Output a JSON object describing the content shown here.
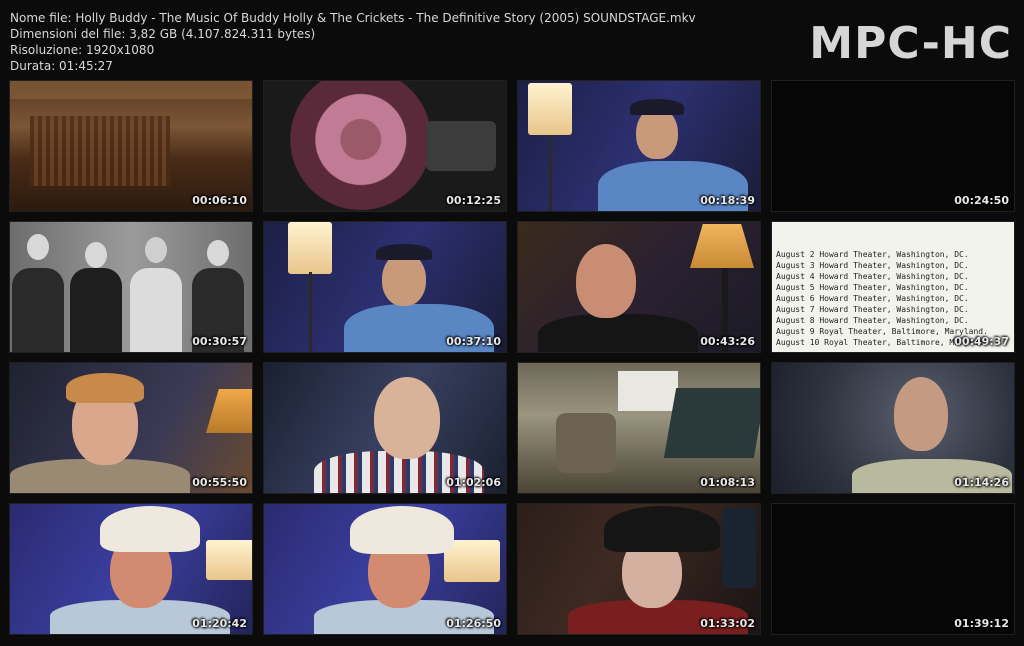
{
  "file_info": {
    "name": "Nome file: Holly Buddy - The Music Of Buddy Holly & The Crickets - The Definitive Story (2005) SOUNDSTAGE.mkv",
    "size": "Dimensioni del file: 3,82 GB (4.107.824.311 bytes)",
    "resolution": "Risoluzione: 1920x1080",
    "duration": "Durata: 01:45:27"
  },
  "logo": "MPC-HC",
  "thumbnails": [
    {
      "timestamp": "00:06:10",
      "scene": "theater-interior"
    },
    {
      "timestamp": "00:12:25",
      "scene": "decca-record-player"
    },
    {
      "timestamp": "00:18:39",
      "scene": "man-blue-shirt-lamp"
    },
    {
      "timestamp": "00:24:50",
      "scene": "black-frame"
    },
    {
      "timestamp": "00:30:57",
      "scene": "band-photo-bw"
    },
    {
      "timestamp": "00:37:10",
      "scene": "man-blue-shirt-gesturing"
    },
    {
      "timestamp": "00:43:26",
      "scene": "smiling-man-lamp"
    },
    {
      "timestamp": "00:49:37",
      "scene": "tour-schedule-document"
    },
    {
      "timestamp": "00:55:50",
      "scene": "woman-interview"
    },
    {
      "timestamp": "01:02:06",
      "scene": "man-striped-shirt"
    },
    {
      "timestamp": "01:08:13",
      "scene": "recording-studio"
    },
    {
      "timestamp": "01:14:26",
      "scene": "gray-haired-man"
    },
    {
      "timestamp": "01:20:42",
      "scene": "man-cowboy-hat"
    },
    {
      "timestamp": "01:26:50",
      "scene": "man-cowboy-hat-2"
    },
    {
      "timestamp": "01:33:02",
      "scene": "man-black-hat-studio"
    },
    {
      "timestamp": "01:39:12",
      "scene": "black-frame"
    }
  ],
  "document_lines": [
    "August 2    Howard Theater, Washington, DC.",
    "August 3    Howard Theater, Washington, DC.",
    "August 4    Howard Theater, Washington, DC.",
    "August 5    Howard Theater, Washington, DC.",
    "August 6    Howard Theater, Washington, DC.",
    "August 7    Howard Theater, Washington, DC.",
    "August 8    Howard Theater, Washington, DC.",
    "August 9    Royal Theater, Baltimore, Maryland.",
    "August 10   Royal Theater, Baltimore, Maryland."
  ]
}
